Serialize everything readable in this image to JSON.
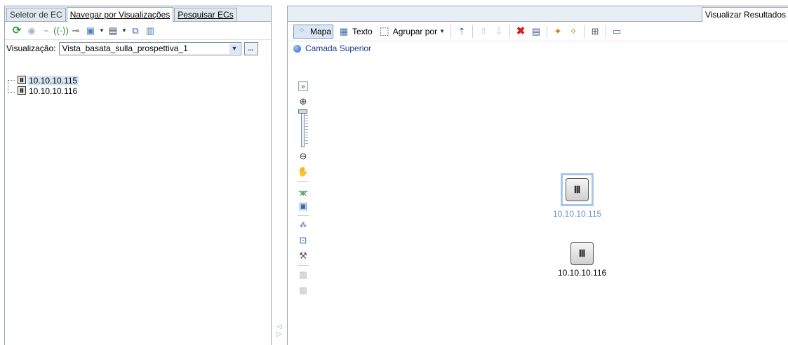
{
  "left": {
    "tabs": [
      {
        "label": "Seletor de EC"
      },
      {
        "label": "Navegar por Visualizações"
      },
      {
        "label": "Pesquisar ECs"
      }
    ],
    "view_label": "Visualização:",
    "view_value": "Vista_basata_sulla_prospettiva_1",
    "more_label": "...",
    "tree": [
      {
        "label": "10.10.10.115",
        "selected": true
      },
      {
        "label": "10.10.10.116",
        "selected": false
      }
    ]
  },
  "right": {
    "tab_label": "Visualizar Resultados",
    "toolbar": {
      "map_label": "Mapa",
      "text_label": "Texto",
      "group_label": "Agrupar por"
    },
    "breadcrumb": "Camada Superior",
    "nodes": [
      {
        "label": "10.10.10.115",
        "selected": true
      },
      {
        "label": "10.10.10.116",
        "selected": false
      }
    ]
  },
  "colors": {
    "accent": "#1a3c8c",
    "selection": "#a9c7ec",
    "panel_border": "#9aa6b4"
  },
  "icons": {
    "left_toolbar": [
      "refresh-icon",
      "show-icon",
      "hide-icon",
      "signal-icon",
      "link-icon",
      "new-icon",
      "save-icon",
      "export-icon",
      "report-icon"
    ],
    "map_toolbar": [
      "map-icon",
      "table-icon",
      "group-icon",
      "up-icon",
      "up-disabled-icon",
      "down-disabled-icon",
      "delete-icon",
      "properties-icon",
      "add-icon",
      "add-related-icon",
      "layout-icon",
      "window-icon"
    ],
    "vertical_toolbar": [
      "expand-icon",
      "zoom-in-icon",
      "zoom-out-icon",
      "pan-icon",
      "hierarchy-icon",
      "fit-icon",
      "tree-layout-icon",
      "orthogonal-icon",
      "tools-icon",
      "disabled-a-icon",
      "disabled-b-icon"
    ]
  }
}
